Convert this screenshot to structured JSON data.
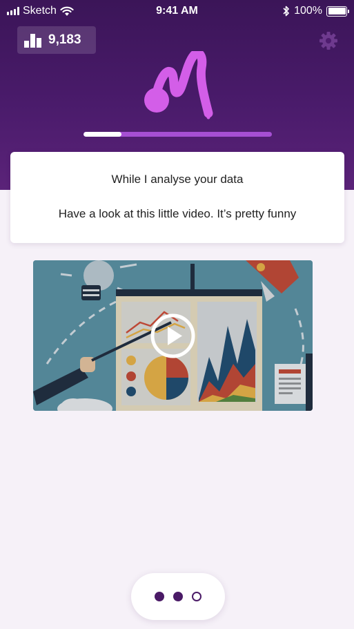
{
  "status_bar": {
    "carrier": "Sketch",
    "time": "9:41 AM",
    "battery_text": "100%",
    "icons": [
      "signal-icon",
      "wifi-icon",
      "bluetooth-icon",
      "battery-icon"
    ]
  },
  "header": {
    "score": "9,183",
    "score_icon": "bar-chart-icon",
    "settings_icon": "gear-icon",
    "logo_icon": "brand-logo-icon",
    "progress": 0.2
  },
  "message": {
    "line1": "While I analyse your data",
    "line2": "Have a look at this little video. It’s pretty funny"
  },
  "video": {
    "thumbnail": "presentation-illustration",
    "play_icon": "play-icon"
  },
  "pager": {
    "count": 3,
    "states": [
      "filled",
      "filled",
      "empty"
    ]
  },
  "colors": {
    "header_dark": "#3b1558",
    "header_light": "#5b2379",
    "accent": "#d35ee8",
    "progress_track": "#a64fd3",
    "background": "#f6f1f8",
    "dot": "#4a1a66"
  }
}
